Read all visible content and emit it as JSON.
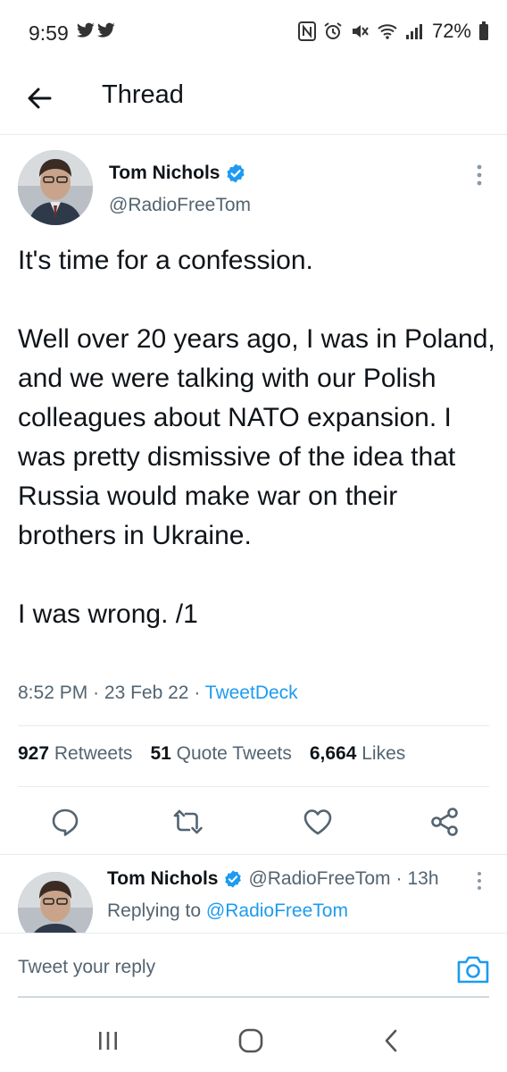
{
  "status_bar": {
    "time": "9:59",
    "left_icons": [
      "twitter-icon",
      "twitter-icon"
    ],
    "right_icons": [
      "nfc-icon",
      "alarm-icon",
      "mute-icon",
      "wifi-icon",
      "signal-icon"
    ],
    "battery": "72%"
  },
  "header": {
    "title": "Thread"
  },
  "tweet": {
    "author_name": "Tom Nichols",
    "author_handle": "@RadioFreeTom",
    "verified": true,
    "paragraphs": [
      "It's time for a confession.",
      "Well over 20 years ago, I was in Poland, and we were talking with our Polish colleagues about NATO expansion. I was pretty dismissive of the idea that Russia would make war on their brothers in Ukraine.",
      "I was wrong.  /1"
    ],
    "time": "8:52 PM",
    "date": "23 Feb 22",
    "separator": "·",
    "source": "TweetDeck",
    "stats": {
      "retweets_count": "927",
      "retweets_label": "Retweets",
      "quotes_count": "51",
      "quotes_label": "Quote Tweets",
      "likes_count": "6,664",
      "likes_label": "Likes"
    },
    "actions": [
      "reply-icon",
      "retweet-icon",
      "like-icon",
      "share-icon"
    ]
  },
  "reply": {
    "author_name": "Tom Nichols",
    "author_handle": "@RadioFreeTom",
    "separator": "·",
    "time_ago": "13h",
    "replying_prefix": "Replying to",
    "replying_to": "@RadioFreeTom"
  },
  "composer": {
    "placeholder": "Tweet your reply"
  },
  "colors": {
    "accent": "#1d9bf0",
    "text": "#0f1419",
    "muted": "#536471",
    "divider": "#e6ecf0"
  }
}
